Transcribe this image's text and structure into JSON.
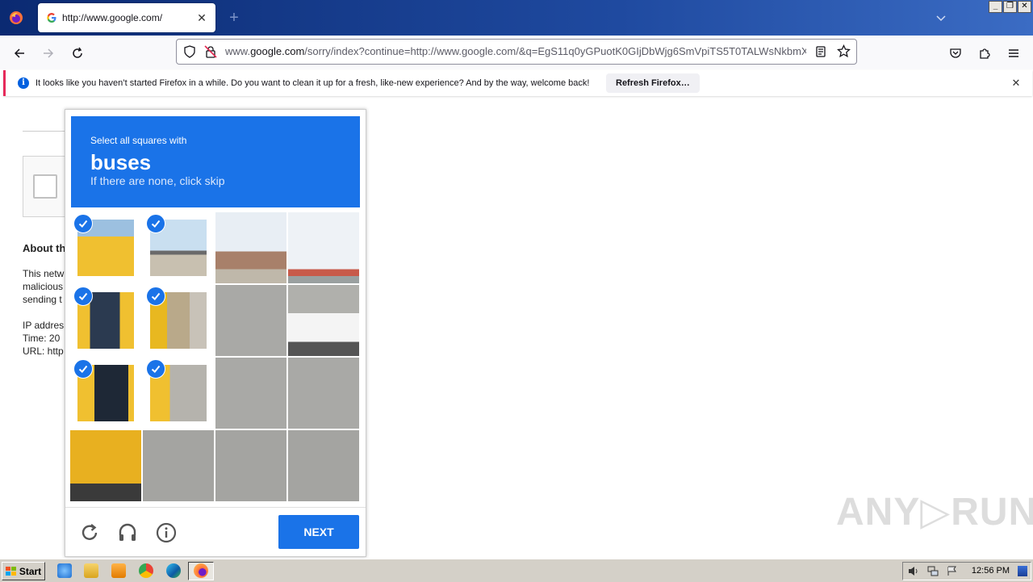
{
  "browser": {
    "tab": {
      "title": "http://www.google.com/"
    },
    "url": {
      "prefix": "www.",
      "host": "google.com",
      "rest": "/sorry/index?continue=http://www.google.com/&q=EgS11q0yGPuotK0GIjDbWjg6SmVpiTS5T0TALWsNkbmX"
    }
  },
  "notification": {
    "text": "It looks like you haven’t started Firefox in a while. Do you want to clean it up for a fresh, like-new experience? And by the way, welcome back!",
    "button_label": "Refresh Firefox…"
  },
  "page": {
    "about_heading": "About th",
    "lines": [
      "This netw",
      "malicious",
      "sending t",
      "IP addres",
      "Time: 20",
      "URL: http"
    ]
  },
  "captcha": {
    "instruction_pre": "Select all squares with",
    "instruction_target": "buses",
    "instruction_post": "If there are none, click skip",
    "next_label": "NEXT",
    "tiles": [
      {
        "selected": true,
        "scene": "bus-top"
      },
      {
        "selected": true,
        "scene": "bus-light"
      },
      {
        "selected": false,
        "scene": "trees"
      },
      {
        "selected": false,
        "scene": "sky"
      },
      {
        "selected": true,
        "scene": "bus-window"
      },
      {
        "selected": true,
        "scene": "bus-side"
      },
      {
        "selected": false,
        "scene": "road"
      },
      {
        "selected": false,
        "scene": "car"
      },
      {
        "selected": true,
        "scene": "bus-front"
      },
      {
        "selected": true,
        "scene": "bus-corner"
      },
      {
        "selected": false,
        "scene": "road"
      },
      {
        "selected": false,
        "scene": "road"
      },
      {
        "selected": false,
        "scene": "bus-bottom"
      },
      {
        "selected": false,
        "scene": "asphalt"
      },
      {
        "selected": false,
        "scene": "asphalt"
      },
      {
        "selected": false,
        "scene": "asphalt"
      }
    ]
  },
  "watermark": "ANY▷RUN",
  "taskbar": {
    "start_label": "Start",
    "clock": "12:56 PM"
  },
  "colors": {
    "accent": "#1a73e8",
    "title_bar": "#1f4aa0",
    "notif_stripe": "#e62a5a"
  }
}
